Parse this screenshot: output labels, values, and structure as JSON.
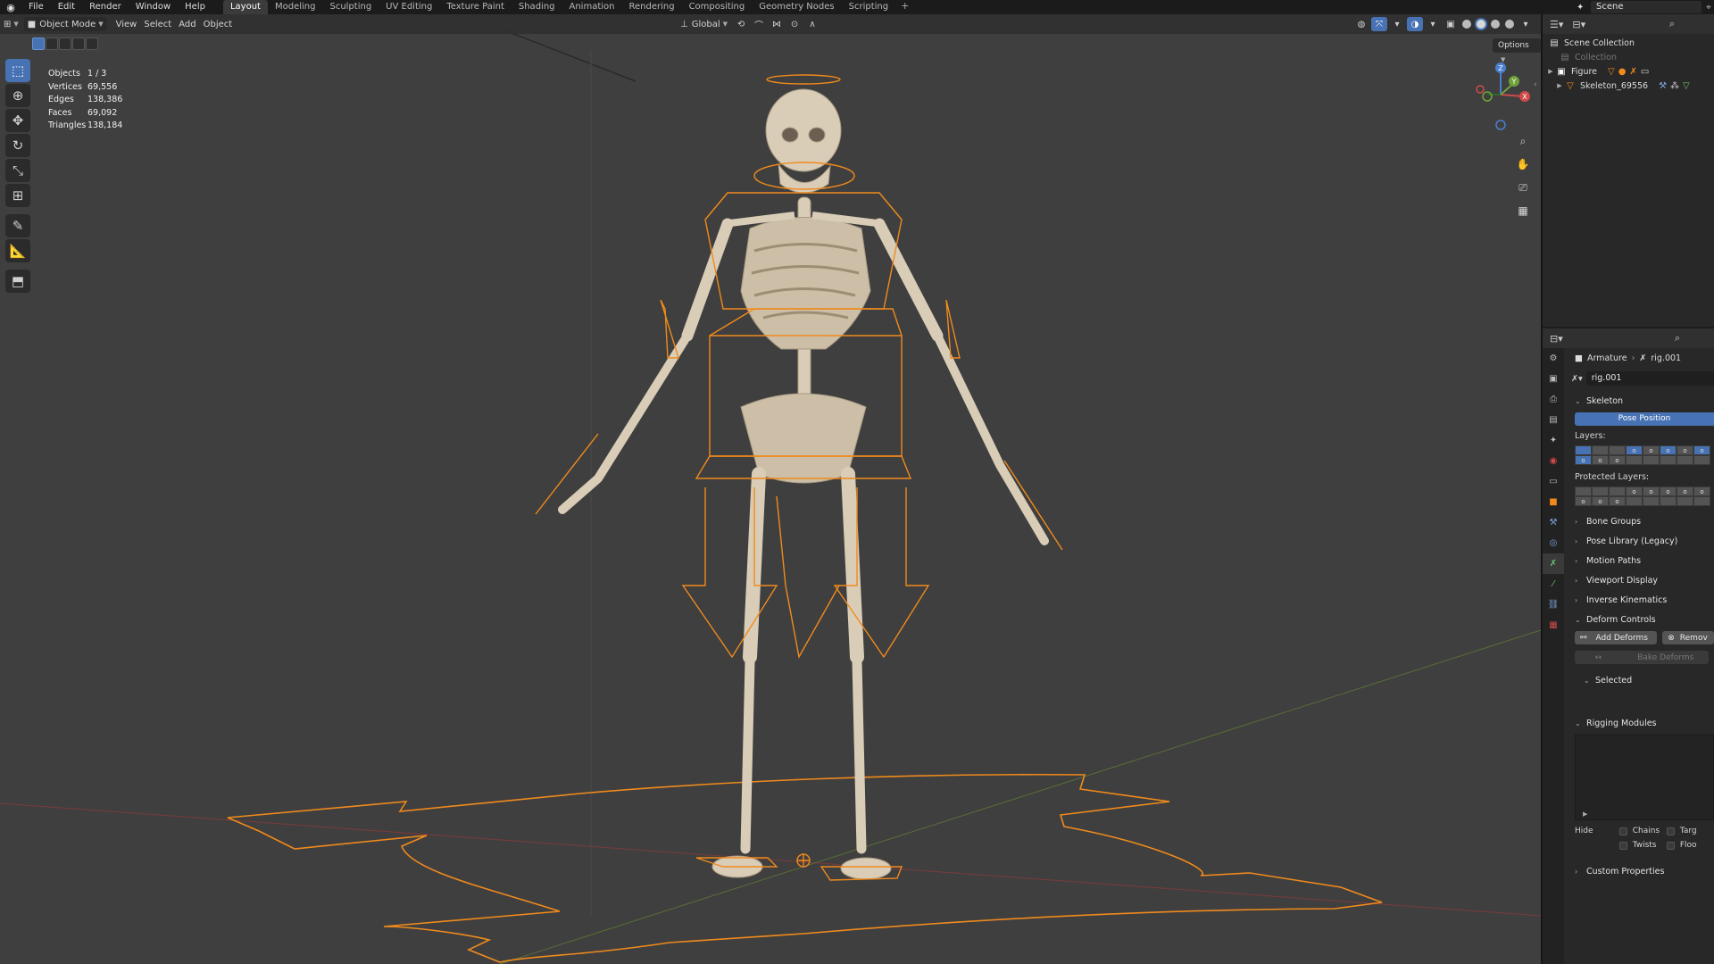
{
  "menu": {
    "items": [
      "File",
      "Edit",
      "Render",
      "Window",
      "Help"
    ],
    "workspaces": [
      "Layout",
      "Modeling",
      "Sculpting",
      "UV Editing",
      "Texture Paint",
      "Shading",
      "Animation",
      "Rendering",
      "Compositing",
      "Geometry Nodes",
      "Scripting"
    ],
    "active_workspace": "Layout",
    "add_label": "+",
    "scene_name": "Scene"
  },
  "viewport_header": {
    "mode": "Object Mode",
    "menus": [
      "View",
      "Select",
      "Add",
      "Object"
    ],
    "orientation": "Global",
    "options_label": "Options"
  },
  "stats": [
    {
      "label": "Objects",
      "value": "1 / 3"
    },
    {
      "label": "Vertices",
      "value": "69,556"
    },
    {
      "label": "Edges",
      "value": "138,386"
    },
    {
      "label": "Faces",
      "value": "69,092"
    },
    {
      "label": "Triangles",
      "value": "138,184"
    }
  ],
  "gizmo": {
    "z": "Z",
    "y": "Y",
    "x": "X"
  },
  "toolbar_tools": [
    "select-box",
    "cursor",
    "move",
    "rotate",
    "scale",
    "transform",
    "annotate",
    "measure",
    "add-cube"
  ],
  "outliner": {
    "root": "Scene Collection",
    "items": [
      {
        "label": "Collection",
        "dim": true
      },
      {
        "label": "Figure",
        "dim": false
      },
      {
        "label": "Skeleton_69556",
        "dim": false
      }
    ]
  },
  "properties": {
    "breadcrumb": {
      "object": "Armature",
      "data": "rig.001"
    },
    "datablock": "rig.001",
    "skeleton_header": "Skeleton",
    "pose_position": "Pose Position",
    "layers_label": "Layers:",
    "protected_layers_label": "Protected Layers:",
    "layers_row1": [
      {
        "t": "",
        "on": true
      },
      {
        "t": "",
        "on": false
      },
      {
        "t": "",
        "on": false
      },
      {
        "t": "o",
        "on": true
      },
      {
        "t": "o",
        "on": false
      },
      {
        "t": "o",
        "on": true
      },
      {
        "t": "o",
        "on": false
      },
      {
        "t": "o",
        "on": true
      }
    ],
    "layers_row2": [
      {
        "t": "o",
        "on": true
      },
      {
        "t": "o",
        "on": false
      },
      {
        "t": "o",
        "on": false
      },
      {
        "t": "",
        "on": false
      },
      {
        "t": "",
        "on": false
      },
      {
        "t": "",
        "on": false
      },
      {
        "t": "",
        "on": false
      },
      {
        "t": "",
        "on": false
      }
    ],
    "protected_row1": [
      "",
      "",
      "",
      "o",
      "o",
      "o",
      "o",
      "o"
    ],
    "protected_row2": [
      "o",
      "o",
      "o",
      "",
      "",
      "",
      "",
      ""
    ],
    "collapsed_panels": [
      "Bone Groups",
      "Pose Library (Legacy)",
      "Motion Paths",
      "Viewport Display",
      "Inverse Kinematics"
    ],
    "deform_header": "Deform Controls",
    "add_deforms": "Add Deforms",
    "remove_deforms": "Remov",
    "bake_deforms": "Bake Deforms",
    "selected_header": "Selected",
    "rigging_header": "Rigging Modules",
    "hide_label": "Hide",
    "hide_options": [
      "Chains",
      "Targ",
      "Twists",
      "Floo"
    ],
    "custom_props": "Custom Properties"
  },
  "colors": {
    "accent": "#4772b3",
    "armature": "#f08a1c",
    "bone": "#d9cdb8",
    "viewport_bg": "#3f3f3f"
  }
}
